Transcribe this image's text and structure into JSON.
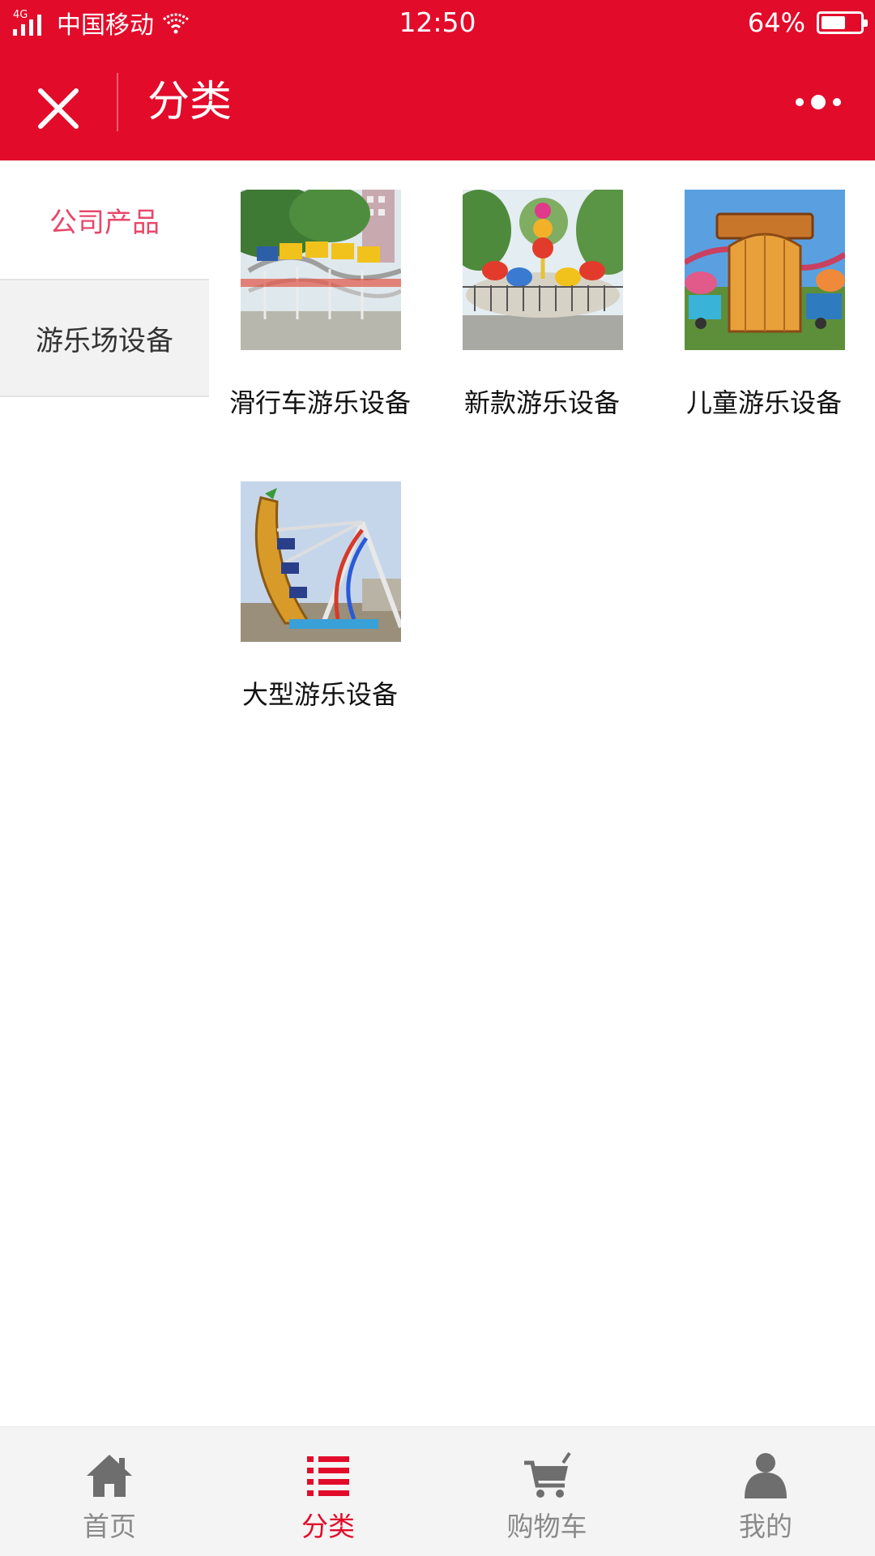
{
  "status_bar": {
    "network": "4G",
    "carrier": "中国移动",
    "time": "12:50",
    "battery": "64%",
    "battery_level": 0.64
  },
  "nav": {
    "title": "分类"
  },
  "sidebar": {
    "items": [
      {
        "label": "公司产品",
        "active": true
      },
      {
        "label": "游乐场设备",
        "active": false
      }
    ]
  },
  "products": [
    {
      "name": "滑行车游乐设备"
    },
    {
      "name": "新款游乐设备"
    },
    {
      "name": "儿童游乐设备"
    },
    {
      "name": "大型游乐设备"
    }
  ],
  "tabs": [
    {
      "label": "首页",
      "icon": "home-icon"
    },
    {
      "label": "分类",
      "icon": "list-icon"
    },
    {
      "label": "购物车",
      "icon": "cart-icon"
    },
    {
      "label": "我的",
      "icon": "user-icon"
    }
  ],
  "colors": {
    "brand": "#e30b2a",
    "sidebar_active": "#e8476a",
    "tab_inactive": "#8a8a8a"
  }
}
